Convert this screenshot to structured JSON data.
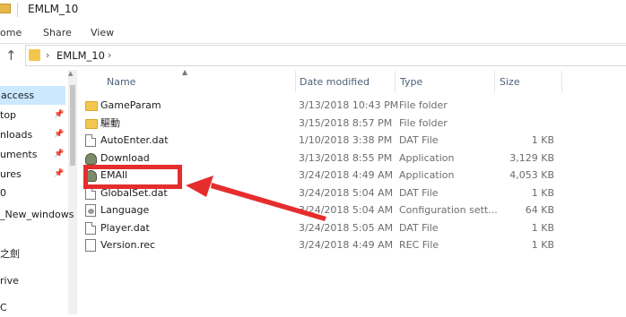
{
  "window": {
    "title": "EMLM_10"
  },
  "ribbon": {
    "tabs": [
      "ome",
      "Share",
      "View"
    ]
  },
  "address": {
    "path": "EMLM_10"
  },
  "nav": {
    "items": [
      {
        "label": "access",
        "pinned": false,
        "selected": true
      },
      {
        "label": "top",
        "pinned": true
      },
      {
        "label": "nloads",
        "pinned": true
      },
      {
        "label": "uments",
        "pinned": true
      },
      {
        "label": "ures",
        "pinned": true
      },
      {
        "label": "0",
        "pinned": false
      },
      {
        "label": "_New_windows",
        "pinned": false
      },
      {
        "label": "之劍",
        "pinned": false
      },
      {
        "label": "rive",
        "pinned": false
      },
      {
        "label": "C",
        "pinned": false
      }
    ]
  },
  "columns": {
    "name": "Name",
    "date": "Date modified",
    "type": "Type",
    "size": "Size"
  },
  "files": [
    {
      "name": "GameParam",
      "date": "3/13/2018 10:43 PM",
      "type": "File folder",
      "size": "",
      "icon": "folder-icon"
    },
    {
      "name": "驅動",
      "date": "3/15/2018 8:57 PM",
      "type": "File folder",
      "size": "",
      "icon": "folder-icon"
    },
    {
      "name": "AutoEnter.dat",
      "date": "1/10/2018 3:38 PM",
      "type": "DAT File",
      "size": "1 KB",
      "icon": "file-icon"
    },
    {
      "name": "Download",
      "date": "3/13/2018 8:55 PM",
      "type": "Application",
      "size": "3,129 KB",
      "icon": "app-icon"
    },
    {
      "name": "EMAll",
      "date": "3/24/2018 4:49 AM",
      "type": "Application",
      "size": "4,053 KB",
      "icon": "app-icon"
    },
    {
      "name": "GlobalSet.dat",
      "date": "3/24/2018 5:04 AM",
      "type": "DAT File",
      "size": "1 KB",
      "icon": "file-icon"
    },
    {
      "name": "Language",
      "date": "3/24/2018 5:04 AM",
      "type": "Configuration sett...",
      "size": "64 KB",
      "icon": "language-file-icon"
    },
    {
      "name": "Player.dat",
      "date": "3/24/2018 5:05 AM",
      "type": "DAT File",
      "size": "1 KB",
      "icon": "file-icon"
    },
    {
      "name": "Version.rec",
      "date": "3/24/2018 4:49 AM",
      "type": "REC File",
      "size": "1 KB",
      "icon": "rec-file-icon"
    }
  ],
  "annotation": {
    "color": "#e52d2d"
  }
}
